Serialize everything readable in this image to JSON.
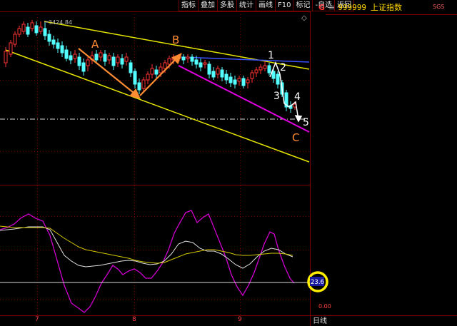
{
  "toolbar": {
    "buttons": [
      "指标",
      "叠加",
      "多股",
      "统计",
      "画线",
      "F10",
      "标记",
      "-自选",
      "返回"
    ],
    "diamond": "◇"
  },
  "header": {
    "g_label": "G",
    "separator": "≡",
    "code": "999999",
    "name": "上证指数",
    "tag": "SGS"
  },
  "annotations": {
    "A": "A",
    "B": "B",
    "C": "C",
    "w1": "1",
    "w2": "2",
    "w3": "3",
    "w4": "4",
    "w5": "5",
    "high_price": "3424.84",
    "indicator_value": "23.6",
    "indicator_zero": "0.00"
  },
  "x_axis": [
    "7",
    "8",
    "9"
  ],
  "period_label": "日线",
  "colors": {
    "up": "#ff3232",
    "down": "#54ffff",
    "channel": "#e6e600",
    "arrow": "#ff8c32",
    "magenta": "#e000e0",
    "blue": "#3c50ff",
    "highlight": "#ffee00",
    "grid": "#7a0000"
  }
}
